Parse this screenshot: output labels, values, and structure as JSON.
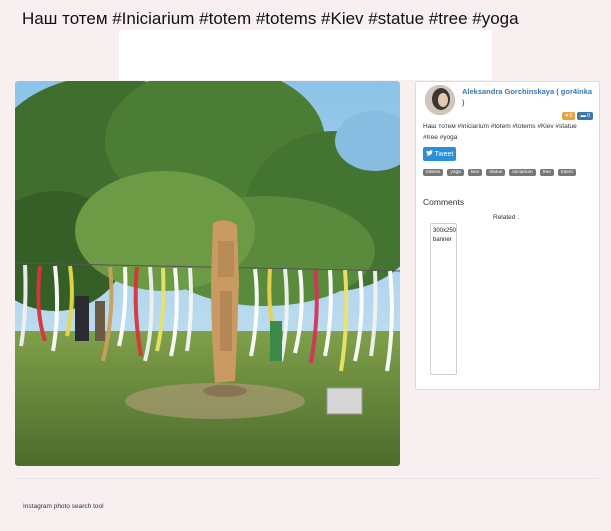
{
  "page": {
    "title": "Наш тотем #Iniciarium #totem #totems #Kiev #statue #tree #yoga"
  },
  "post": {
    "image_icon": "photo-totem-statue",
    "user": {
      "name": "Aleksandra Gorchinskaya ( gor4inka )"
    },
    "badges": {
      "likes": "6",
      "comments": "0"
    },
    "caption": "Наш тотем #Iniciarium #totem #totems #Kiev #statue #tree #yoga",
    "tweet_label": "Tweet",
    "tags": [
      "totems",
      "yoga",
      "kiev",
      "statue",
      "iniciarium",
      "tree",
      "totem"
    ],
    "comments_heading": "Comments",
    "related_label": "Related :",
    "ad_slot_text": "300x250 banner"
  },
  "footer": {
    "text": "Instagram photo search tool"
  },
  "colors": {
    "background": "#f8eff1",
    "link": "#3a78b0",
    "tweet": "#2b8fd7",
    "likes": "#e8a33c",
    "tag": "#777777"
  }
}
